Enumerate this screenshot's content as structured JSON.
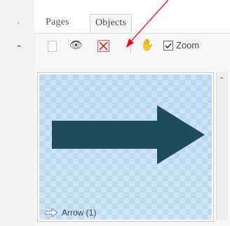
{
  "tabs": {
    "pages_label": "Pages",
    "objects_label": "Objects"
  },
  "left_strip": {
    "expand_glyph": "›",
    "collapse_glyph": "⌃"
  },
  "toolbar": {
    "lock_icon": "lock-icon",
    "eye_icon": "eye-icon",
    "delete_icon": "delete-object-icon",
    "hand_icon": "hand-tool-icon",
    "zoom_checkbox_checked": true,
    "zoom_label": "Zoom"
  },
  "object_list": {
    "items": [
      {
        "caption": "Arrow (1)",
        "shape": "right-arrow",
        "fill_color": "#1f4b5e"
      }
    ]
  },
  "scrollbar": {
    "up_glyph": "⌃"
  },
  "annotation": {
    "arrow_color": "#ff0000",
    "points_to": "delete-object-icon"
  },
  "colors": {
    "tab_bar_bg": "#ffffff",
    "panel_bg": "#f7f7f7",
    "thumbnail_bg": "#bcdaf0",
    "delete_icon_red": "#d26060"
  }
}
